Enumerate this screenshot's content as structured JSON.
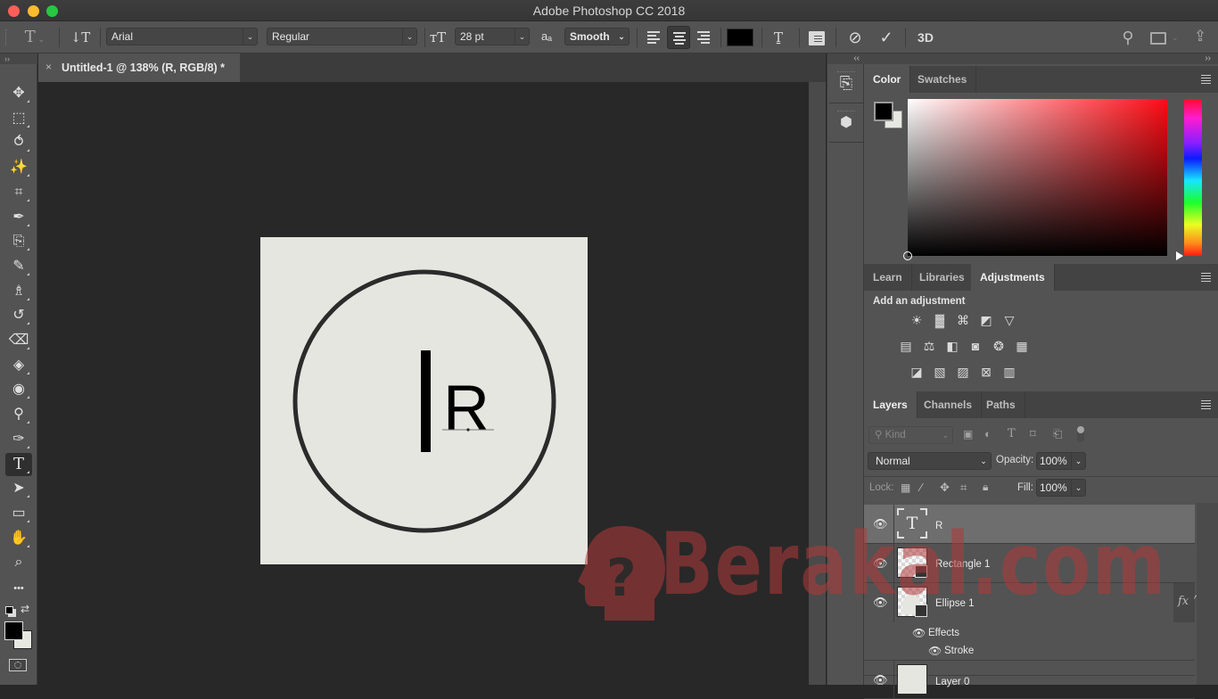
{
  "window": {
    "title": "Adobe Photoshop CC 2018",
    "traffic_lights": [
      {
        "name": "close",
        "color": "#fc5f57"
      },
      {
        "name": "minimize",
        "color": "#fdbc2e"
      },
      {
        "name": "maximize",
        "color": "#28c840"
      }
    ]
  },
  "options_bar": {
    "tool_icon": "type-tool-icon",
    "font_family": "Arial",
    "font_style": "Regular",
    "font_size": "28 pt",
    "antialias_label": "aₐ",
    "antialias": "Smooth",
    "alignment": [
      "left",
      "center",
      "right"
    ],
    "active_alignment": "center",
    "text_color": "#000000",
    "threed_label": "3D"
  },
  "toolbar": {
    "collapse": "››",
    "tools": [
      {
        "name": "move-tool",
        "glyph": "✥"
      },
      {
        "name": "marquee-tool",
        "glyph": "⬚"
      },
      {
        "name": "lasso-tool",
        "glyph": "⥀"
      },
      {
        "name": "magic-wand-tool",
        "glyph": "✨"
      },
      {
        "name": "crop-tool",
        "glyph": "⌗"
      },
      {
        "name": "eyedropper-tool",
        "glyph": "✒"
      },
      {
        "name": "healing-brush-tool",
        "glyph": "⎘"
      },
      {
        "name": "brush-tool",
        "glyph": "✎"
      },
      {
        "name": "clone-stamp-tool",
        "glyph": "♗"
      },
      {
        "name": "history-brush-tool",
        "glyph": "↺"
      },
      {
        "name": "eraser-tool",
        "glyph": "⌫"
      },
      {
        "name": "paint-bucket-tool",
        "glyph": "◈"
      },
      {
        "name": "blur-tool",
        "glyph": "◉"
      },
      {
        "name": "dodge-tool",
        "glyph": "⚲"
      },
      {
        "name": "pen-tool",
        "glyph": "✑"
      },
      {
        "name": "type-tool",
        "glyph": "T"
      },
      {
        "name": "path-selection-tool",
        "glyph": "➤"
      },
      {
        "name": "rectangle-tool",
        "glyph": "▭"
      },
      {
        "name": "hand-tool",
        "glyph": "✋"
      },
      {
        "name": "zoom-tool",
        "glyph": "⌕"
      },
      {
        "name": "edit-toolbar",
        "glyph": "•••"
      }
    ],
    "active_tool": "type-tool",
    "foreground_color": "#000000",
    "background_color": "#e8e8e3"
  },
  "document": {
    "tab_close": "×",
    "tab_title": "Untitled-1 @ 138% (R, RGB/8) *",
    "text_content": "R",
    "paper_color": "#e6e6e1",
    "ring_color": "#2b2b2b"
  },
  "icon_strip": {
    "collapse": "‹‹",
    "buttons": [
      "history-icon",
      "3d-properties-icon"
    ]
  },
  "right_collapse": "››",
  "color_panel": {
    "tabs": [
      "Color",
      "Swatches"
    ],
    "active_tab": "Color",
    "hue_color": "#ff0b14",
    "foreground": "#000000",
    "background": "#e8e8e3"
  },
  "adjust_panel": {
    "tabs": [
      "Learn",
      "Libraries",
      "Adjustments"
    ],
    "active_tab": "Adjustments",
    "heading": "Add an adjustment",
    "rows": [
      [
        {
          "name": "brightness-contrast-icon",
          "glyph": "☀"
        },
        {
          "name": "levels-icon",
          "glyph": "▓"
        },
        {
          "name": "curves-icon",
          "glyph": "⌘"
        },
        {
          "name": "exposure-icon",
          "glyph": "◩"
        },
        {
          "name": "vibrance-icon",
          "glyph": "▽"
        }
      ],
      [
        {
          "name": "hue-saturation-icon",
          "glyph": "▤"
        },
        {
          "name": "color-balance-icon",
          "glyph": "⚖"
        },
        {
          "name": "black-white-icon",
          "glyph": "◧"
        },
        {
          "name": "photo-filter-icon",
          "glyph": "◙"
        },
        {
          "name": "channel-mixer-icon",
          "glyph": "❂"
        },
        {
          "name": "color-lookup-icon",
          "glyph": "▦"
        }
      ],
      [
        {
          "name": "invert-icon",
          "glyph": "◪"
        },
        {
          "name": "posterize-icon",
          "glyph": "▧"
        },
        {
          "name": "threshold-icon",
          "glyph": "▨"
        },
        {
          "name": "selective-color-icon",
          "glyph": "⊠"
        },
        {
          "name": "gradient-map-icon",
          "glyph": "▥"
        }
      ]
    ]
  },
  "layers_panel": {
    "tabs": [
      "Layers",
      "Channels",
      "Paths"
    ],
    "active_tab": "Layers",
    "filter_placeholder": "Kind",
    "blend_mode": "Normal",
    "opacity_label": "Opacity:",
    "opacity": "100%",
    "lock_label": "Lock:",
    "fill_label": "Fill:",
    "fill": "100%",
    "layers": [
      {
        "name": "R",
        "type": "text",
        "selected": true
      },
      {
        "name": "Rectangle 1",
        "type": "shape"
      },
      {
        "name": "Ellipse 1",
        "type": "shape",
        "fx": "fx",
        "effects_label": "Effects",
        "effects": [
          "Stroke"
        ]
      },
      {
        "name": "Layer 0",
        "type": "pixel"
      }
    ]
  },
  "watermark": {
    "text": "Berakal.com",
    "glyph": "?"
  }
}
